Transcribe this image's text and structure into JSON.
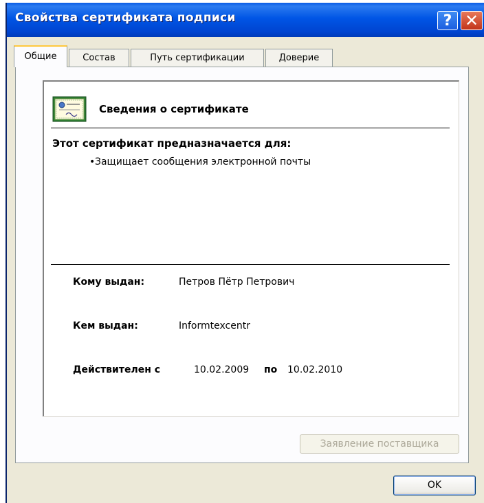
{
  "window": {
    "title": "Свойства сертификата подписи",
    "help_glyph": "?",
    "close_glyph": "✕"
  },
  "tabs": [
    {
      "label": "Общие",
      "active": true
    },
    {
      "label": "Состав",
      "active": false
    },
    {
      "label": "Путь сертификации",
      "active": false
    },
    {
      "label": "Доверие",
      "active": false
    }
  ],
  "general": {
    "heading": "Сведения о сертификате",
    "purpose_title": "Этот сертификат предназначается для:",
    "purposes": [
      "Защищает сообщения электронной почты"
    ],
    "bullet": "•",
    "issued_to_label": "Кому выдан:",
    "issued_to_value": "Петров Пётр Петрович",
    "issued_by_label": "Кем выдан:",
    "issued_by_value": "Informtexcentr",
    "valid_from_label": "Действителен с",
    "valid_from_value": "10.02.2009",
    "valid_to_label": "по",
    "valid_to_value": "10.02.2010"
  },
  "buttons": {
    "vendor_statement": "Заявление поставщика",
    "ok": "OK"
  },
  "icons": {
    "certificate": "certificate-icon",
    "help": "help-icon",
    "close": "close-icon"
  },
  "colors": {
    "titlebar": "#0055e5",
    "active_tab_accent": "#ffc83c",
    "close_button": "#c2341a"
  }
}
